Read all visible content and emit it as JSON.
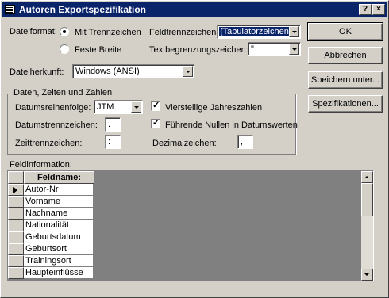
{
  "window": {
    "title": "Autoren Exportspezifikation",
    "help_glyph": "?",
    "close_glyph": "×"
  },
  "format": {
    "label": "Dateiformat:",
    "option_delimited": "Mit Trennzeichen",
    "option_fixed": "Feste Breite",
    "selected": "Mit Trennzeichen"
  },
  "field_delimiter": {
    "label": "Feldtrennzeichen:",
    "value": "{Tabulatorzeichen}"
  },
  "text_qualifier": {
    "label": "Textbegrenzungszeichen:",
    "value": "\""
  },
  "file_origin": {
    "label": "Dateiherkunft:",
    "value": "Windows (ANSI)"
  },
  "dates_group": {
    "title": "Daten, Zeiten und Zahlen",
    "date_order_label": "Datumsreihenfolge:",
    "date_order_value": "JTM",
    "date_sep_label": "Datumstrennzeichen:",
    "date_sep_value": ".",
    "time_sep_label": "Zeittrennzeichen:",
    "time_sep_value": ":",
    "four_digit_years_label": "Vierstellige Jahreszahlen",
    "four_digit_years_checked": true,
    "leading_zeros_label": "Führende Nullen in Datumswerten",
    "leading_zeros_checked": true,
    "decimal_label": "Dezimalzeichen:",
    "decimal_value": ","
  },
  "buttons": {
    "ok": "OK",
    "cancel": "Abbrechen",
    "save_as": "Speichern unter...",
    "specs": "Spezifikationen..."
  },
  "field_info": {
    "label": "Feldinformation:",
    "column_header": "Feldname:",
    "rows": [
      "Autor-Nr",
      "Vorname",
      "Nachname",
      "Nationalität",
      "Geburtsdatum",
      "Geburtsort",
      "Trainingsort",
      "Haupteinflüsse"
    ],
    "current_row": 0
  }
}
